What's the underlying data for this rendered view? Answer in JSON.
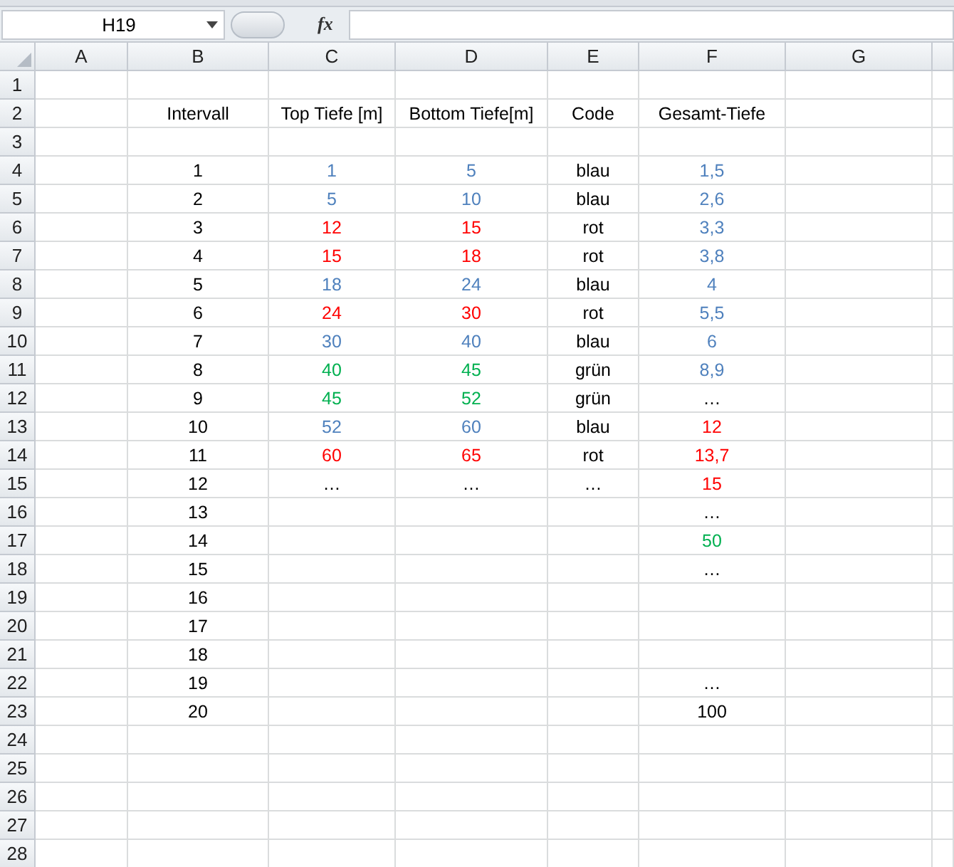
{
  "formula_bar": {
    "name_box": "H19",
    "function_label": "fx"
  },
  "columns": [
    "A",
    "B",
    "C",
    "D",
    "E",
    "F",
    "G"
  ],
  "rows": [
    {
      "number": "1",
      "cells": {}
    },
    {
      "number": "2",
      "cells": {
        "B": {
          "text": "Intervall"
        },
        "C": {
          "text": "Top Tiefe [m]"
        },
        "D": {
          "text": "Bottom Tiefe[m]"
        },
        "E": {
          "text": "Code"
        },
        "F": {
          "text": "Gesamt-Tiefe"
        }
      }
    },
    {
      "number": "3",
      "cells": {}
    },
    {
      "number": "4",
      "cells": {
        "B": {
          "text": "1"
        },
        "C": {
          "text": "1",
          "color": "#4f81bd"
        },
        "D": {
          "text": "5",
          "color": "#4f81bd"
        },
        "E": {
          "text": "blau"
        },
        "F": {
          "text": "1,5",
          "color": "#4f81bd"
        }
      }
    },
    {
      "number": "5",
      "cells": {
        "B": {
          "text": "2"
        },
        "C": {
          "text": "5",
          "color": "#4f81bd"
        },
        "D": {
          "text": "10",
          "color": "#4f81bd"
        },
        "E": {
          "text": "blau"
        },
        "F": {
          "text": "2,6",
          "color": "#4f81bd"
        }
      }
    },
    {
      "number": "6",
      "cells": {
        "B": {
          "text": "3"
        },
        "C": {
          "text": "12",
          "color": "#ff0000"
        },
        "D": {
          "text": "15",
          "color": "#ff0000"
        },
        "E": {
          "text": "rot"
        },
        "F": {
          "text": "3,3",
          "color": "#4f81bd"
        }
      }
    },
    {
      "number": "7",
      "cells": {
        "B": {
          "text": "4"
        },
        "C": {
          "text": "15",
          "color": "#ff0000"
        },
        "D": {
          "text": "18",
          "color": "#ff0000"
        },
        "E": {
          "text": "rot"
        },
        "F": {
          "text": "3,8",
          "color": "#4f81bd"
        }
      }
    },
    {
      "number": "8",
      "cells": {
        "B": {
          "text": "5"
        },
        "C": {
          "text": "18",
          "color": "#4f81bd"
        },
        "D": {
          "text": "24",
          "color": "#4f81bd"
        },
        "E": {
          "text": "blau"
        },
        "F": {
          "text": "4",
          "color": "#4f81bd"
        }
      }
    },
    {
      "number": "9",
      "cells": {
        "B": {
          "text": "6"
        },
        "C": {
          "text": "24",
          "color": "#ff0000"
        },
        "D": {
          "text": "30",
          "color": "#ff0000"
        },
        "E": {
          "text": "rot"
        },
        "F": {
          "text": "5,5",
          "color": "#4f81bd"
        }
      }
    },
    {
      "number": "10",
      "cells": {
        "B": {
          "text": "7"
        },
        "C": {
          "text": "30",
          "color": "#4f81bd"
        },
        "D": {
          "text": "40",
          "color": "#4f81bd"
        },
        "E": {
          "text": "blau"
        },
        "F": {
          "text": "6",
          "color": "#4f81bd"
        }
      }
    },
    {
      "number": "11",
      "cells": {
        "B": {
          "text": "8"
        },
        "C": {
          "text": "40",
          "color": "#00b050"
        },
        "D": {
          "text": "45",
          "color": "#00b050"
        },
        "E": {
          "text": "grün"
        },
        "F": {
          "text": "8,9",
          "color": "#4f81bd"
        }
      }
    },
    {
      "number": "12",
      "cells": {
        "B": {
          "text": "9"
        },
        "C": {
          "text": "45",
          "color": "#00b050"
        },
        "D": {
          "text": "52",
          "color": "#00b050"
        },
        "E": {
          "text": "grün"
        },
        "F": {
          "text": "…"
        }
      }
    },
    {
      "number": "13",
      "cells": {
        "B": {
          "text": "10"
        },
        "C": {
          "text": "52",
          "color": "#4f81bd"
        },
        "D": {
          "text": "60",
          "color": "#4f81bd"
        },
        "E": {
          "text": "blau"
        },
        "F": {
          "text": "12",
          "color": "#ff0000"
        }
      }
    },
    {
      "number": "14",
      "cells": {
        "B": {
          "text": "11"
        },
        "C": {
          "text": "60",
          "color": "#ff0000"
        },
        "D": {
          "text": "65",
          "color": "#ff0000"
        },
        "E": {
          "text": "rot"
        },
        "F": {
          "text": "13,7",
          "color": "#ff0000"
        }
      }
    },
    {
      "number": "15",
      "cells": {
        "B": {
          "text": "12"
        },
        "C": {
          "text": "…"
        },
        "D": {
          "text": "…"
        },
        "E": {
          "text": "…"
        },
        "F": {
          "text": "15",
          "color": "#ff0000"
        }
      }
    },
    {
      "number": "16",
      "cells": {
        "B": {
          "text": "13"
        },
        "F": {
          "text": "…"
        }
      }
    },
    {
      "number": "17",
      "cells": {
        "B": {
          "text": "14"
        },
        "F": {
          "text": "50",
          "color": "#00b050"
        }
      }
    },
    {
      "number": "18",
      "cells": {
        "B": {
          "text": "15"
        },
        "F": {
          "text": "…"
        }
      }
    },
    {
      "number": "19",
      "cells": {
        "B": {
          "text": "16"
        }
      }
    },
    {
      "number": "20",
      "cells": {
        "B": {
          "text": "17"
        }
      }
    },
    {
      "number": "21",
      "cells": {
        "B": {
          "text": "18"
        }
      }
    },
    {
      "number": "22",
      "cells": {
        "B": {
          "text": "19"
        },
        "F": {
          "text": "…"
        }
      }
    },
    {
      "number": "23",
      "cells": {
        "B": {
          "text": "20"
        },
        "F": {
          "text": "100"
        }
      }
    },
    {
      "number": "24",
      "cells": {}
    },
    {
      "number": "25",
      "cells": {}
    },
    {
      "number": "26",
      "cells": {}
    },
    {
      "number": "27",
      "cells": {}
    },
    {
      "number": "28",
      "cells": {}
    }
  ]
}
